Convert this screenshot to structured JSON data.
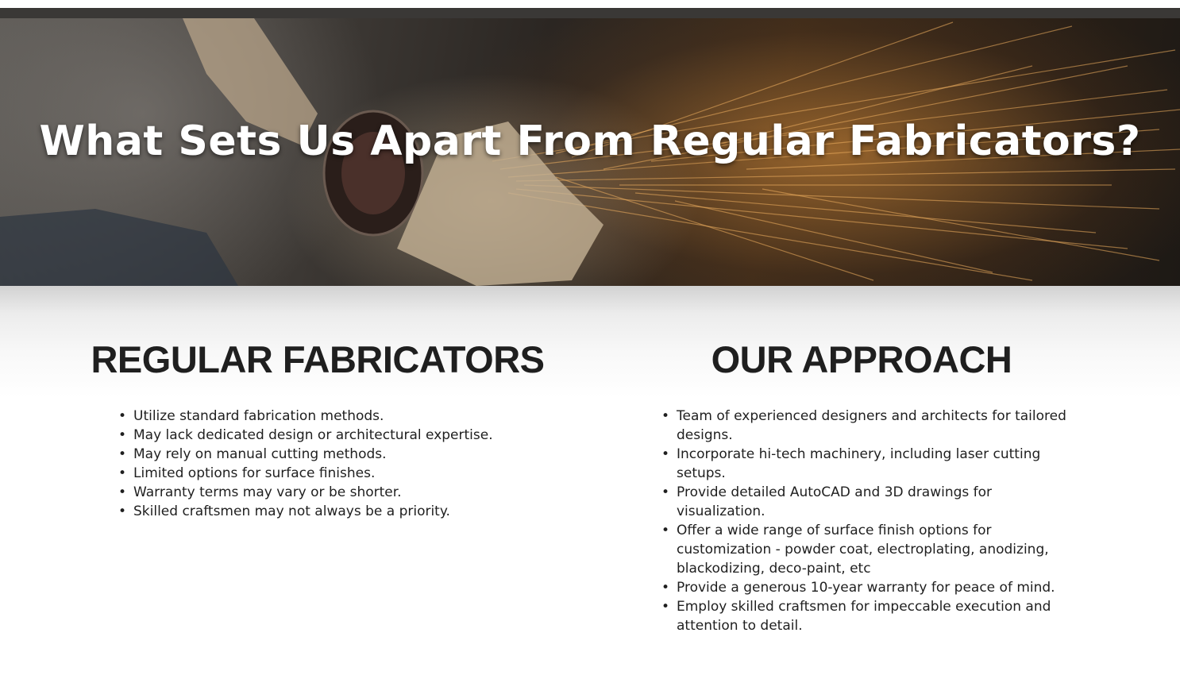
{
  "hero": {
    "title": "What Sets Us Apart From Regular Fabricators?"
  },
  "comparison": {
    "regular": {
      "heading": "REGULAR FABRICATORS",
      "items": [
        "Utilize standard fabrication methods.",
        "May lack dedicated design or architectural expertise.",
        "May rely on manual cutting methods.",
        "Limited options for surface finishes.",
        "Warranty terms may vary or be shorter.",
        "Skilled craftsmen may not always be a priority."
      ]
    },
    "ours": {
      "heading": "OUR APPROACH",
      "items": [
        "Team of experienced designers and architects for tailored designs.",
        "Incorporate hi-tech machinery, including laser cutting setups.",
        "Provide detailed AutoCAD and 3D drawings for visualization.",
        "Offer a wide range of surface finish options for customization - powder coat, electroplating, anodizing, blackodizing, deco-paint, etc",
        "Provide a generous 10-year warranty for peace of mind.",
        "Employ skilled craftsmen for impeccable execution and attention to detail."
      ]
    }
  },
  "colors": {
    "text": "#1f1f1f",
    "hero_text": "#ffffff",
    "strip": "#3a3836"
  }
}
